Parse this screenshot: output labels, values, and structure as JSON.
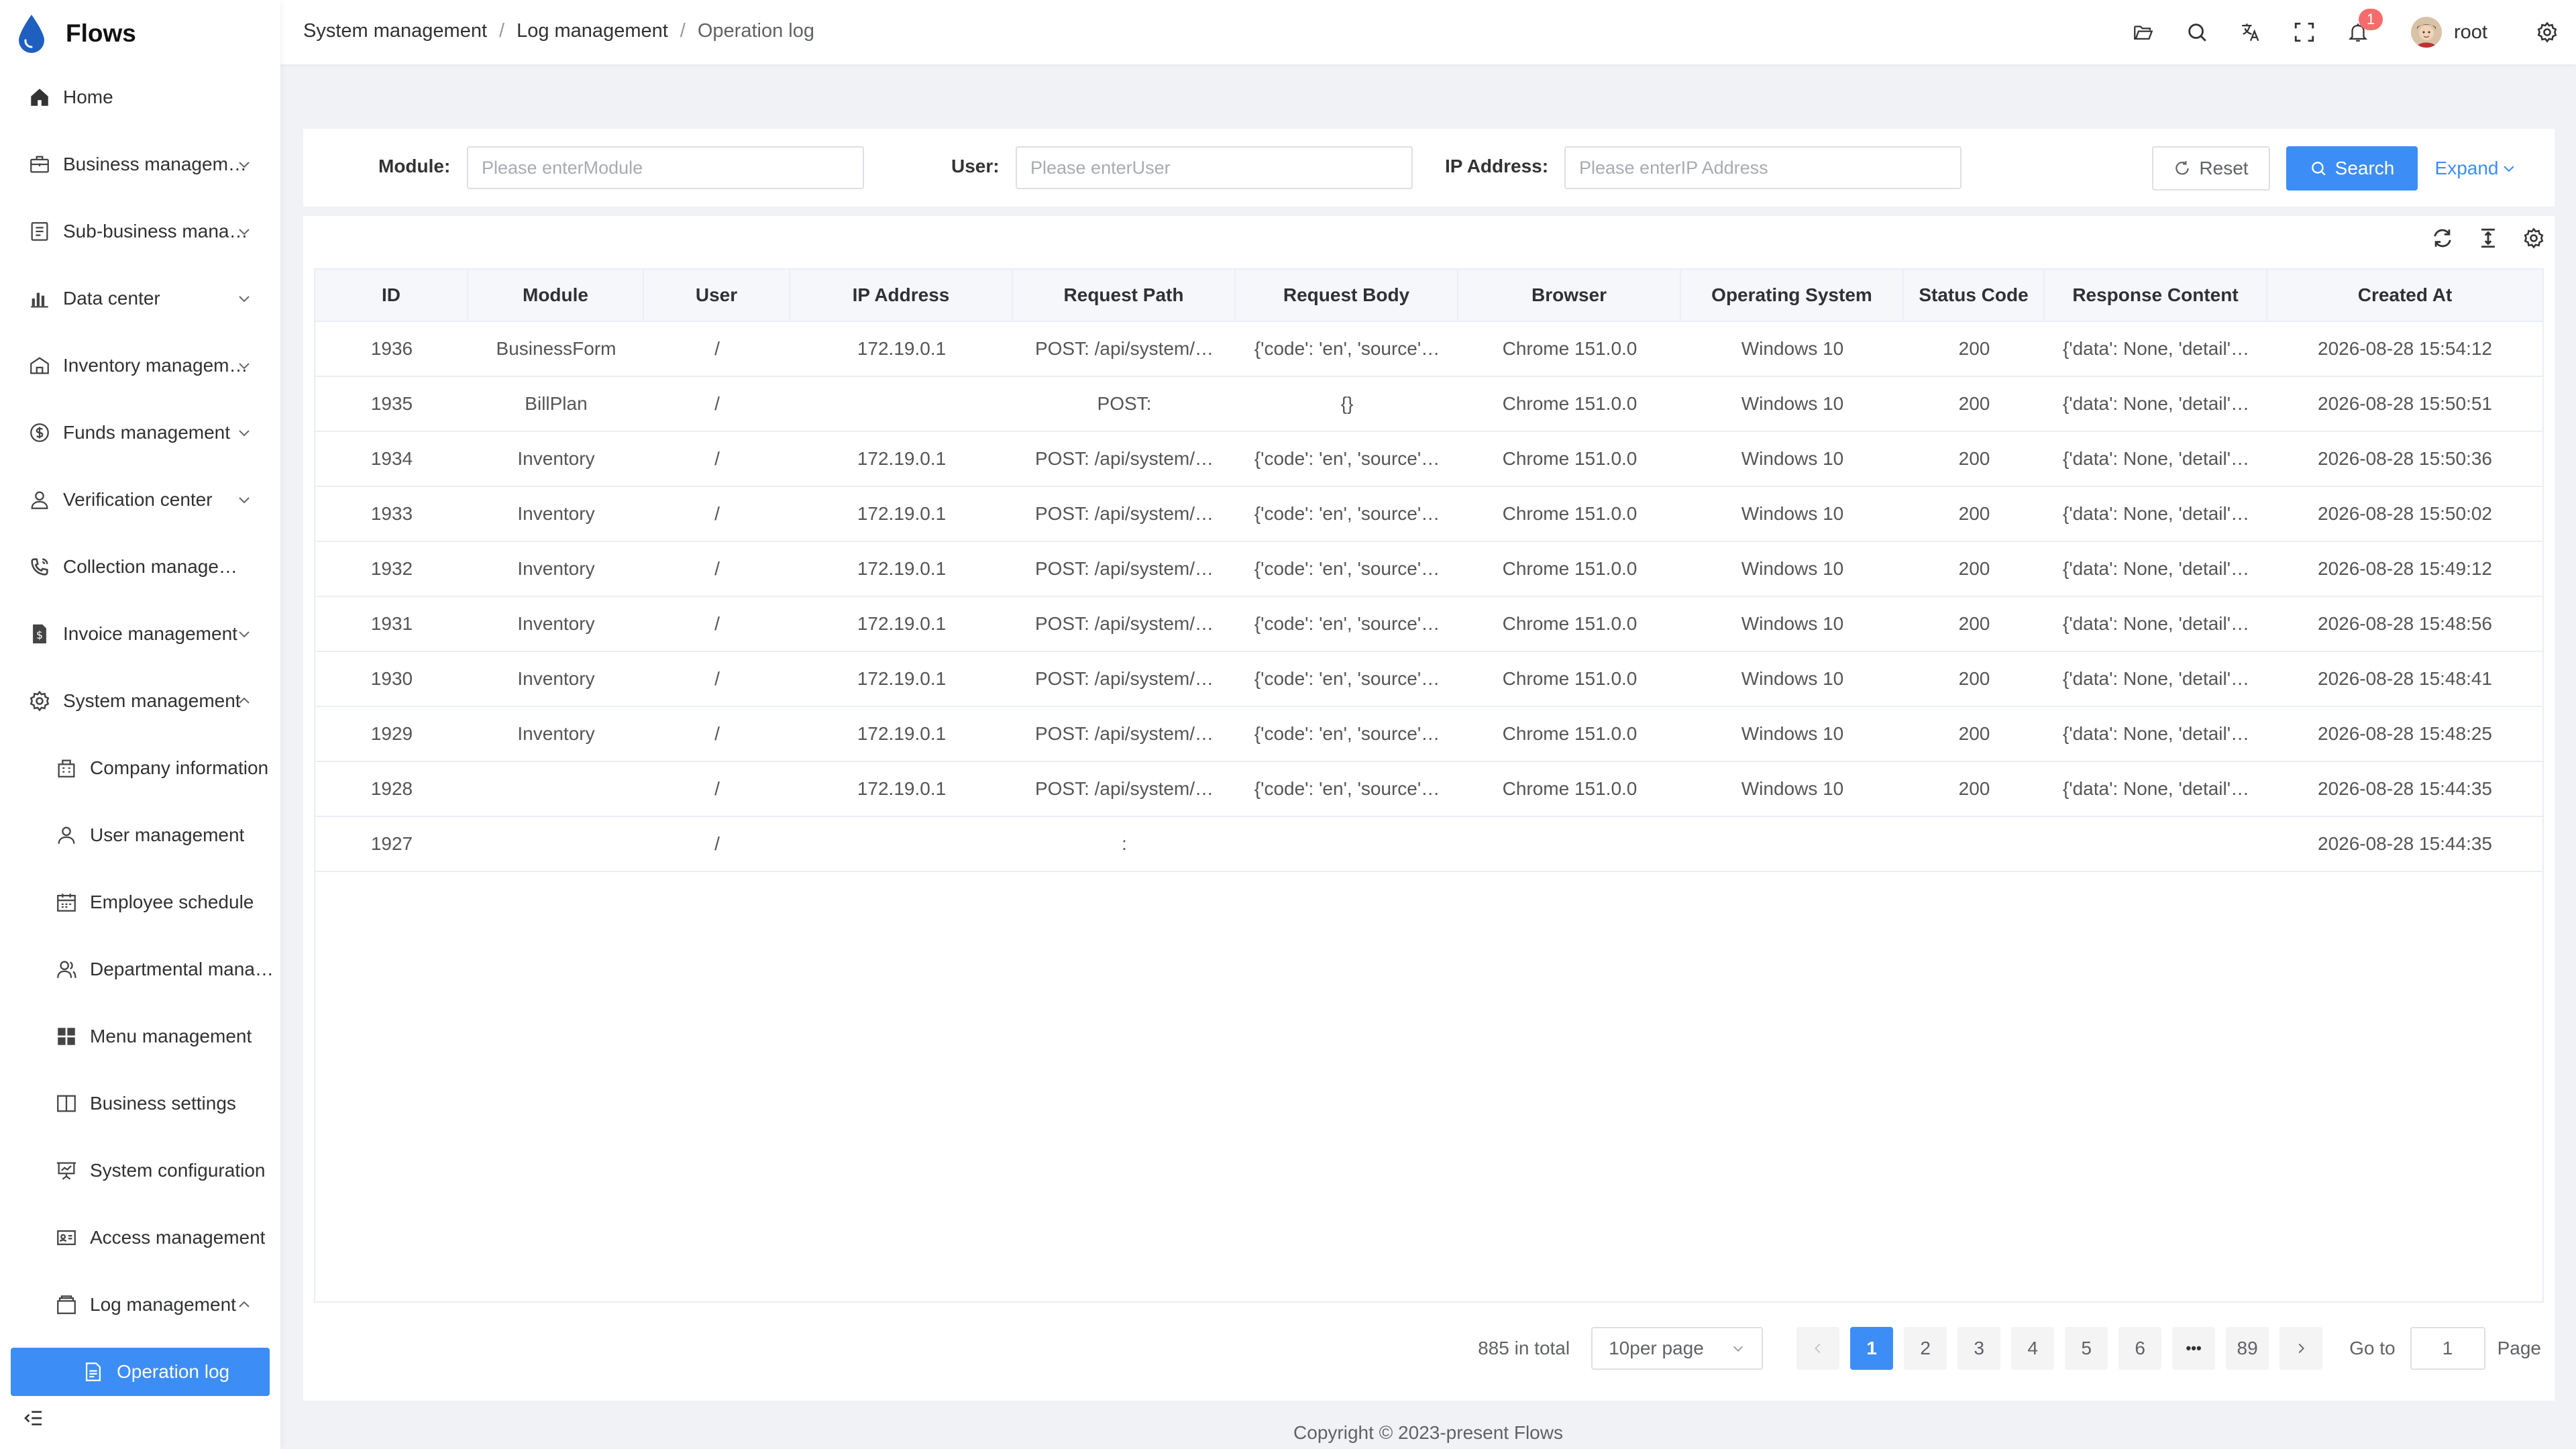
{
  "app": {
    "name": "Flows"
  },
  "sidebar": {
    "items": [
      {
        "label": "Home",
        "icon": "home-icon"
      },
      {
        "label": "Business management",
        "icon": "briefcase-icon"
      },
      {
        "label": "Sub-business management",
        "icon": "document-icon"
      },
      {
        "label": "Data center",
        "icon": "bar-chart-icon"
      },
      {
        "label": "Inventory management",
        "icon": "warehouse-icon"
      },
      {
        "label": "Funds management",
        "icon": "coin-icon"
      },
      {
        "label": "Verification center",
        "icon": "user-check-icon"
      },
      {
        "label": "Collection management",
        "icon": "phone-icon"
      },
      {
        "label": "Invoice management",
        "icon": "invoice-icon"
      },
      {
        "label": "System management",
        "icon": "gear-icon"
      }
    ],
    "system_children": [
      {
        "label": "Company information",
        "icon": "building-icon"
      },
      {
        "label": "User management",
        "icon": "user-icon"
      },
      {
        "label": "Employee schedule",
        "icon": "calendar-icon"
      },
      {
        "label": "Departmental management",
        "icon": "team-icon"
      },
      {
        "label": "Menu management",
        "icon": "grid-icon"
      },
      {
        "label": "Business settings",
        "icon": "book-icon"
      },
      {
        "label": "System configuration",
        "icon": "presentation-icon"
      },
      {
        "label": "Access management",
        "icon": "id-card-icon"
      },
      {
        "label": "Log management",
        "icon": "archive-icon"
      }
    ],
    "active_item": "Operation log"
  },
  "breadcrumb": [
    "System management",
    "Log management",
    "Operation log"
  ],
  "header": {
    "notification_count": "1",
    "username": "root"
  },
  "filters": {
    "module": {
      "label": "Module:",
      "placeholder": "Please enterModule",
      "value": ""
    },
    "user": {
      "label": "User:",
      "placeholder": "Please enterUser",
      "value": ""
    },
    "ip": {
      "label": "IP Address:",
      "placeholder": "Please enterIP Address",
      "value": ""
    },
    "reset_label": "Reset",
    "search_label": "Search",
    "expand_label": "Expand"
  },
  "table": {
    "columns": [
      "ID",
      "Module",
      "User",
      "IP Address",
      "Request Path",
      "Request Body",
      "Browser",
      "Operating System",
      "Status Code",
      "Response Content",
      "Created At"
    ],
    "rows": [
      [
        "1936",
        "BusinessForm",
        "/",
        "172.19.0.1",
        "POST: /api/system/…",
        "{'code': 'en', 'source'…",
        "Chrome 151.0.0",
        "Windows 10",
        "200",
        "{'data': None, 'detail'…",
        "2026-08-28 15:54:12"
      ],
      [
        "1935",
        "BillPlan",
        "/",
        "",
        "POST:",
        "{}",
        "Chrome 151.0.0",
        "Windows 10",
        "200",
        "{'data': None, 'detail'…",
        "2026-08-28 15:50:51"
      ],
      [
        "1934",
        "Inventory",
        "/",
        "172.19.0.1",
        "POST: /api/system/…",
        "{'code': 'en', 'source'…",
        "Chrome 151.0.0",
        "Windows 10",
        "200",
        "{'data': None, 'detail'…",
        "2026-08-28 15:50:36"
      ],
      [
        "1933",
        "Inventory",
        "/",
        "172.19.0.1",
        "POST: /api/system/…",
        "{'code': 'en', 'source'…",
        "Chrome 151.0.0",
        "Windows 10",
        "200",
        "{'data': None, 'detail'…",
        "2026-08-28 15:50:02"
      ],
      [
        "1932",
        "Inventory",
        "/",
        "172.19.0.1",
        "POST: /api/system/…",
        "{'code': 'en', 'source'…",
        "Chrome 151.0.0",
        "Windows 10",
        "200",
        "{'data': None, 'detail'…",
        "2026-08-28 15:49:12"
      ],
      [
        "1931",
        "Inventory",
        "/",
        "172.19.0.1",
        "POST: /api/system/…",
        "{'code': 'en', 'source'…",
        "Chrome 151.0.0",
        "Windows 10",
        "200",
        "{'data': None, 'detail'…",
        "2026-08-28 15:48:56"
      ],
      [
        "1930",
        "Inventory",
        "/",
        "172.19.0.1",
        "POST: /api/system/…",
        "{'code': 'en', 'source'…",
        "Chrome 151.0.0",
        "Windows 10",
        "200",
        "{'data': None, 'detail'…",
        "2026-08-28 15:48:41"
      ],
      [
        "1929",
        "Inventory",
        "/",
        "172.19.0.1",
        "POST: /api/system/…",
        "{'code': 'en', 'source'…",
        "Chrome 151.0.0",
        "Windows 10",
        "200",
        "{'data': None, 'detail'…",
        "2026-08-28 15:48:25"
      ],
      [
        "1928",
        "",
        "/",
        "172.19.0.1",
        "POST: /api/system/…",
        "{'code': 'en', 'source'…",
        "Chrome 151.0.0",
        "Windows 10",
        "200",
        "{'data': None, 'detail'…",
        "2026-08-28 15:44:35"
      ],
      [
        "1927",
        "",
        "/",
        "",
        ":",
        "",
        "",
        "",
        "",
        "",
        "2026-08-28 15:44:35"
      ]
    ]
  },
  "pagination": {
    "total": "885 in total",
    "page_size": "10per page",
    "pages": [
      "1",
      "2",
      "3",
      "4",
      "5",
      "6",
      "•••",
      "89"
    ],
    "current": "1",
    "goto_label": "Go to",
    "goto_value": "1",
    "page_label": "Page"
  },
  "footer": "Copyright © 2023-present Flows",
  "colors": {
    "primary": "#3c8ef6",
    "badge": "#f56c6c",
    "background": "#f0f2f5"
  }
}
